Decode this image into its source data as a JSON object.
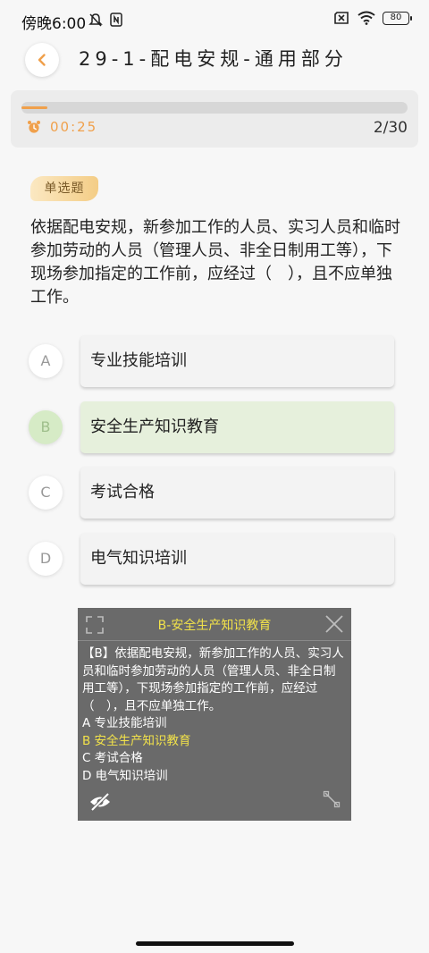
{
  "status_bar": {
    "time": "傍晚6:00",
    "battery": "80",
    "icons": [
      "mute-icon",
      "nfc-icon",
      "sim-off-icon",
      "wifi-icon",
      "battery-icon"
    ]
  },
  "header": {
    "title": "29-1-配电安规-通用部分",
    "back_icon": "chevron-left-icon"
  },
  "progress": {
    "timer": "00:25",
    "count": "2/30",
    "fraction": 0.0667
  },
  "question": {
    "type_label": "单选题",
    "text": "依据配电安规，新参加工作的人员、实习人员和临时参加劳动的人员（管理人员、非全日制用工等），下现场参加指定的工作前，应经过（　），且不应单独工作。"
  },
  "options": [
    {
      "letter": "A",
      "text": "专业技能培训",
      "selected": false
    },
    {
      "letter": "B",
      "text": "安全生产知识教育",
      "selected": true
    },
    {
      "letter": "C",
      "text": "考试合格",
      "selected": false
    },
    {
      "letter": "D",
      "text": "电气知识培训",
      "selected": false
    }
  ],
  "overlay": {
    "title": "B-安全生产知识教育",
    "body": "【B】依据配电安规，新参加工作的人员、实习人员和临时参加劳动的人员（管理人员、非全日制用工等），下现场参加指定的工作前，应经过（　），且不应单独工作。",
    "options": [
      {
        "text": "A 专业技能培训",
        "highlight": false
      },
      {
        "text": "B 安全生产知识教育",
        "highlight": true
      },
      {
        "text": "C 考试合格",
        "highlight": false
      },
      {
        "text": "D 电气知识培训",
        "highlight": false
      }
    ]
  },
  "colors": {
    "accent": "#f0a04b",
    "selected_bg": "#e6f0dc",
    "overlay_highlight": "#f2e24a"
  }
}
